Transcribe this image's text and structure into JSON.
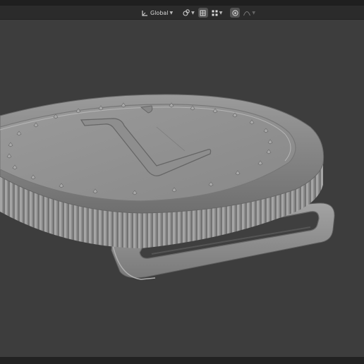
{
  "header": {
    "transform_orientation": {
      "label": "Global",
      "icon": "transform-axes-icon"
    },
    "pivot_icon": "link-pivot-icon",
    "snap_icon": "snap-grid-icon",
    "snap_target_icon": "snap-target-icon",
    "proportional_icon": "proportional-edit-icon",
    "falloff_icon": "falloff-curve-icon"
  },
  "viewport": {
    "background": "#3d3d3d",
    "object": "coin-medal-with-strap-loop",
    "coin_numeral": "1",
    "coin_color": "#8f8f8f"
  }
}
